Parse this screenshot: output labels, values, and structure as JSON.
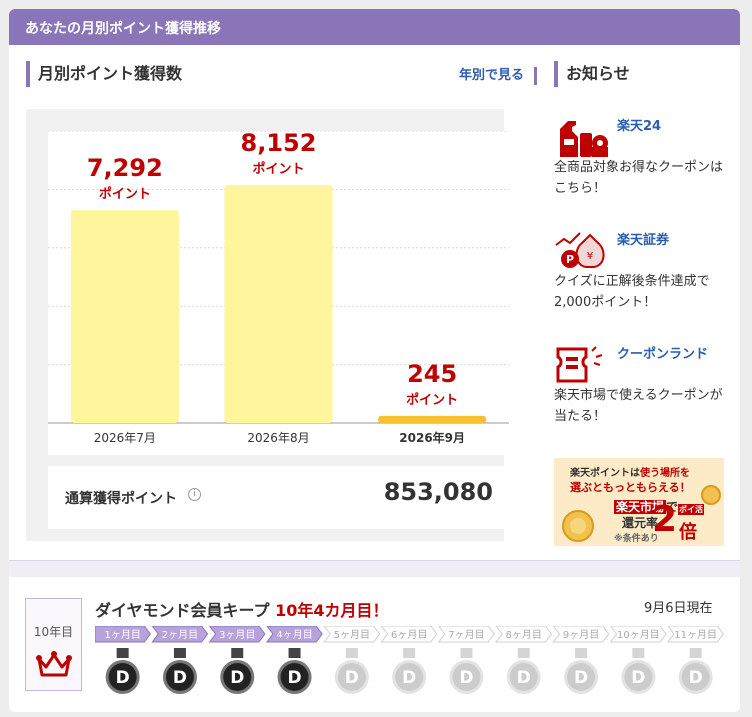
{
  "header": {
    "title": "あなたの月別ポイント獲得推移"
  },
  "monthly": {
    "title": "月別ポイント獲得数",
    "yearly_link": "年別で見る"
  },
  "chart_data": {
    "type": "bar",
    "categories": [
      "2026年7月",
      "2026年8月",
      "2026年9月"
    ],
    "values": [
      7292,
      8152,
      245
    ],
    "value_labels": [
      "7,292",
      "8,152",
      "245"
    ],
    "unit_label": "ポイント",
    "highlight_category": "2026年9月",
    "ylim": [
      0,
      10000
    ],
    "bar_color": "#fff59d",
    "current_bar_color": "#fbc02d",
    "value_color": "#bf0000"
  },
  "total": {
    "label": "通算獲得ポイント",
    "value": "853,080"
  },
  "news": {
    "title": "お知らせ",
    "items": [
      {
        "title": "楽天24",
        "desc": "全商品対象お得なクーポンはこちら！",
        "icon": "cleaning-products-icon"
      },
      {
        "title": "楽天証券",
        "desc": "クイズに正解後条件達成で2,000ポイント！",
        "icon": "money-bag-icon"
      },
      {
        "title": "クーポンランド",
        "desc": "楽天市場で使えるクーポンが当たる！",
        "icon": "coupon-ticket-icon"
      }
    ],
    "banner": {
      "line1a": "楽天ポイントは",
      "line1b": "使う場所を",
      "line2": "選ぶともっともらえる！",
      "line3a": "楽天市場",
      "line3b": "で",
      "line4": "還元率",
      "line5": "※条件あり",
      "big": "2",
      "big_suffix": "倍",
      "tag": "ポイ活"
    }
  },
  "keep": {
    "badge_years": "10年目",
    "title": "ダイヤモンド会員キープ",
    "highlight": "10年4カ月目！",
    "as_of": "9月6日現在",
    "months": [
      "1ヶ月目",
      "2ヶ月目",
      "3ヶ月目",
      "4ヶ月目",
      "5ヶ月目",
      "6ヶ月目",
      "7ヶ月目",
      "8ヶ月目",
      "9ヶ月目",
      "10ヶ月目",
      "11ヶ月目"
    ],
    "achieved": 4,
    "medal_letter": "D"
  }
}
